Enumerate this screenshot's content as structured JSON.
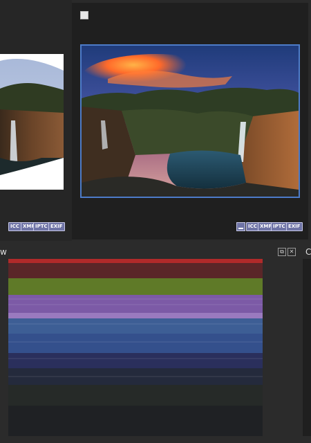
{
  "left_thumb": {
    "badges": [
      "ICC",
      "XMP",
      "IPTC",
      "EXIF"
    ]
  },
  "right_thumb": {
    "badges": [
      "ICC",
      "XMP",
      "IPTC",
      "EXIF"
    ]
  },
  "waveform_panel": {
    "title_fragment": "w"
  },
  "right_panel": {
    "title_fragment": "Ca"
  },
  "colors": {
    "selection_border": "#4d7cc9",
    "badge_bg": "#6f74a6",
    "panel_bg": "#2b2b2b"
  }
}
